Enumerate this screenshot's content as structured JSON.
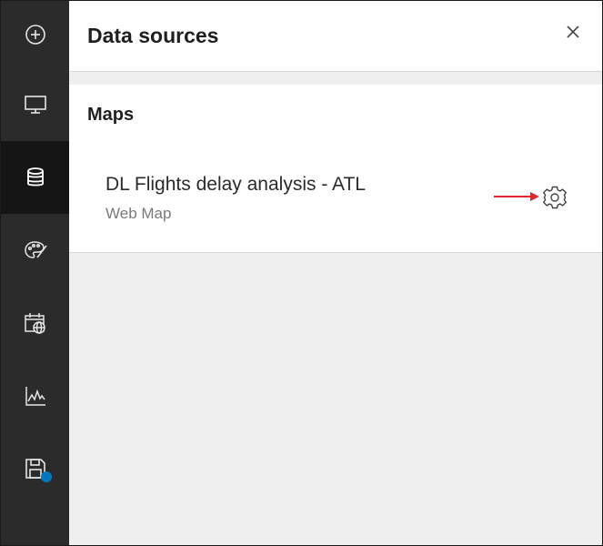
{
  "rail": {
    "items": [
      {
        "icon": "add-circle-icon"
      },
      {
        "icon": "monitor-icon"
      },
      {
        "icon": "database-icon",
        "active": true
      },
      {
        "icon": "palette-icon"
      },
      {
        "icon": "calendar-globe-icon"
      },
      {
        "icon": "chart-line-icon"
      },
      {
        "icon": "save-icon",
        "badge": true
      }
    ],
    "badge_color": "#0079c1"
  },
  "panel": {
    "title": "Data sources",
    "close_label": "×"
  },
  "maps_section": {
    "title": "Maps",
    "sources": [
      {
        "name": "DL Flights delay analysis - ATL",
        "type": "Web Map"
      }
    ]
  },
  "annotation": {
    "arrow_color": "#e0262b"
  }
}
